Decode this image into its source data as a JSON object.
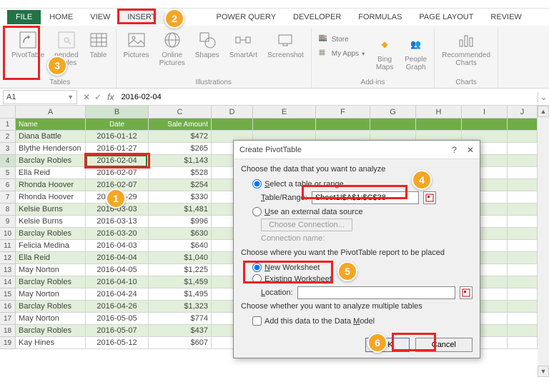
{
  "app": {
    "name_box_value": "A1",
    "formula_value": "2016-02-04"
  },
  "tabs": {
    "file": "FILE",
    "home": "HOME",
    "view": "VIEW",
    "insert": "INSERT",
    "powerquery": "POWER QUERY",
    "developer": "DEVELOPER",
    "formulas": "FORMULAS",
    "pagelayout": "PAGE LAYOUT",
    "review": "REVIEW"
  },
  "ribbon": {
    "tables": {
      "label": "Tables",
      "pivottable": "PivotTable",
      "recommended": "nended\nTables",
      "table": "Table"
    },
    "illustrations": {
      "label": "Illustrations",
      "pictures": "Pictures",
      "online_pictures": "Online\nPictures",
      "shapes": "Shapes",
      "smartart": "SmartArt",
      "screenshot": "Screenshot"
    },
    "addins": {
      "label": "Add-ins",
      "store": "Store",
      "myapps": "My Apps",
      "bing": "Bing\nMaps",
      "people": "People\nGraph"
    },
    "charts": {
      "label": "Charts",
      "recommended": "Recommended\nCharts"
    }
  },
  "columns": [
    "A",
    "B",
    "C",
    "D",
    "E",
    "F",
    "G",
    "H",
    "I",
    "J"
  ],
  "header_row": [
    "Name",
    "Date",
    "Sale Amount"
  ],
  "rows": [
    {
      "n": "Diana Battle",
      "d": "2016-01-12",
      "a": "$472"
    },
    {
      "n": "Blythe Henderson",
      "d": "2016-01-27",
      "a": "$265"
    },
    {
      "n": "Barclay Robles",
      "d": "2016-02-04",
      "a": "$1,143"
    },
    {
      "n": "Ella Reid",
      "d": "2016-02-07",
      "a": "$528"
    },
    {
      "n": "Rhonda Hoover",
      "d": "2016-02-07",
      "a": "$254"
    },
    {
      "n": "Rhonda Hoover",
      "d": "2016-02-29",
      "a": "$330"
    },
    {
      "n": "Kelsie Burns",
      "d": "2016-03-03",
      "a": "$1,481"
    },
    {
      "n": "Kelsie Burns",
      "d": "2016-03-13",
      "a": "$996"
    },
    {
      "n": "Barclay Robles",
      "d": "2016-03-20",
      "a": "$630"
    },
    {
      "n": "Felicia Medina",
      "d": "2016-04-03",
      "a": "$640"
    },
    {
      "n": "Ella Reid",
      "d": "2016-04-04",
      "a": "$1,040"
    },
    {
      "n": "May Norton",
      "d": "2016-04-05",
      "a": "$1,225"
    },
    {
      "n": "Barclay Robles",
      "d": "2016-04-10",
      "a": "$1,459"
    },
    {
      "n": "May Norton",
      "d": "2016-04-24",
      "a": "$1,495"
    },
    {
      "n": "Barclay Robles",
      "d": "2016-04-26",
      "a": "$1,323"
    },
    {
      "n": "May Norton",
      "d": "2016-05-05",
      "a": "$774"
    },
    {
      "n": "Barclay Robles",
      "d": "2016-05-07",
      "a": "$437"
    },
    {
      "n": "Kay Hines",
      "d": "2016-05-12",
      "a": "$607"
    }
  ],
  "dialog": {
    "title": "Create PivotTable",
    "choose_data": "Choose the data that you want to analyze",
    "select_table": "Select a table or range",
    "table_range_label": "Table/Range:",
    "table_range_value": "Sheet1!$A$1:$C$38",
    "external_source": "Use an external data source",
    "choose_connection": "Choose Connection...",
    "connection_name": "Connection name:",
    "choose_where": "Choose where you want the PivotTable report to be placed",
    "new_ws": "New Worksheet",
    "existing_ws": "Existing Worksheet",
    "location_label": "Location:",
    "choose_multi": "Choose whether you want to analyze multiple tables",
    "data_model": "Add this data to the Data Model",
    "ok": "OK",
    "cancel": "Cancel"
  },
  "callouts": {
    "c1": "1",
    "c2": "2",
    "c3": "3",
    "c4": "4",
    "c5": "5",
    "c6": "6"
  }
}
